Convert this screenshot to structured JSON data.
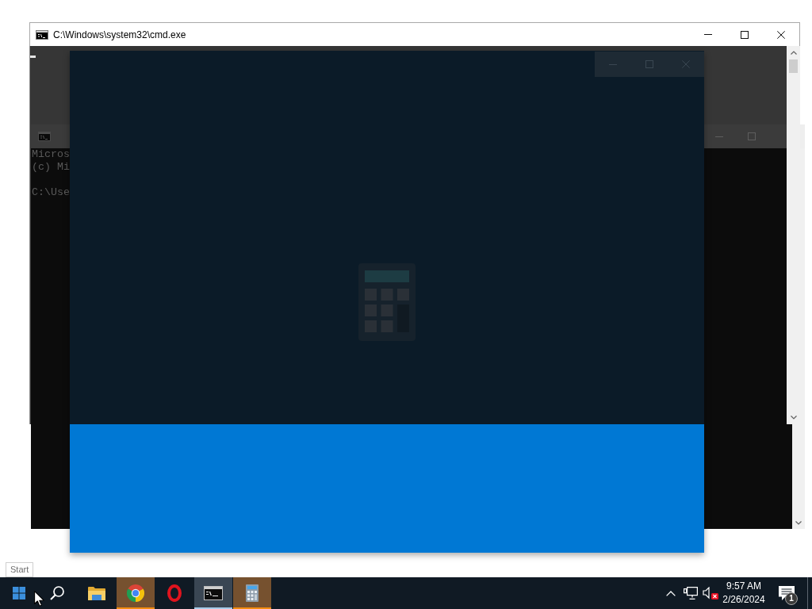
{
  "back_window": {
    "lines": [
      "Micros",
      "(c) Mi"
    ],
    "prompt": "C:\\Use"
  },
  "front_window": {
    "title": "C:\\Windows\\system32\\cmd.exe"
  },
  "tooltip": {
    "text": "Start"
  },
  "taskbar": {
    "apps": [
      {
        "kind": "folder",
        "selected": false,
        "flashing": false
      },
      {
        "kind": "wheel",
        "selected": false,
        "flashing": true
      },
      {
        "kind": "ring",
        "selected": false,
        "flashing": false
      },
      {
        "kind": "terminal",
        "selected": true,
        "flashing": false
      },
      {
        "kind": "calculator",
        "selected": false,
        "flashing": true
      }
    ],
    "tray": {
      "volume": {
        "muted": true
      },
      "clock": {
        "time": "9:57 AM",
        "date": "2/26/2024"
      },
      "notifications": {
        "count": "1"
      }
    }
  }
}
